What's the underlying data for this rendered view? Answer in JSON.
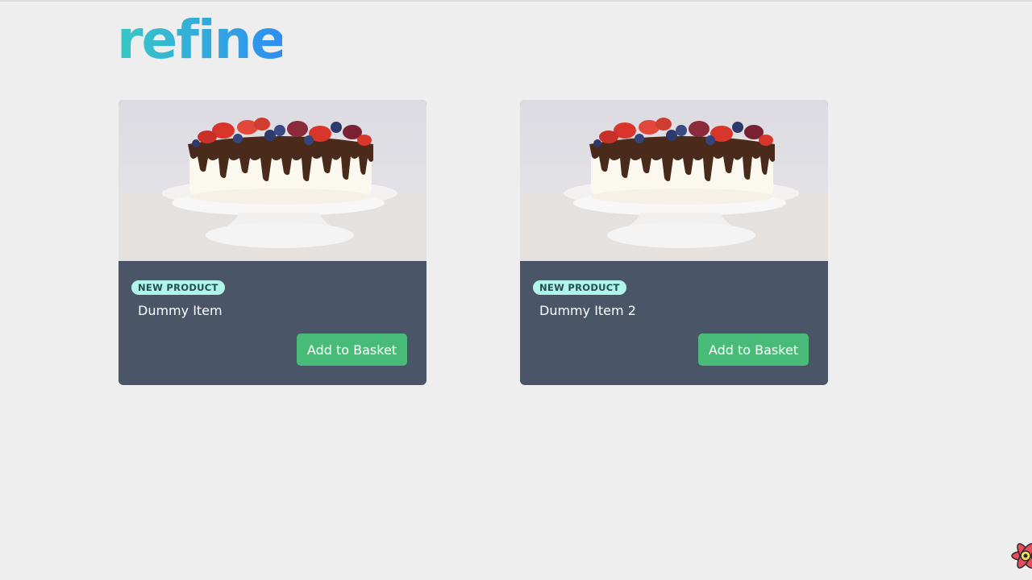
{
  "header": {
    "logo_text": "refine"
  },
  "products": [
    {
      "badge": "NEW PRODUCT",
      "title": "Dummy Item",
      "button_label": "Add to Basket",
      "image_alt": "cake"
    },
    {
      "badge": "NEW PRODUCT",
      "title": "Dummy Item 2",
      "button_label": "Add to Basket",
      "image_alt": "cake"
    }
  ],
  "colors": {
    "background": "#eeeeee",
    "card": "#4a5568",
    "badge_bg": "#b1f5ea",
    "badge_text": "#234e52",
    "button": "#48bb78",
    "logo_teal": "#39c9c3",
    "logo_blue": "#2d8ef2"
  },
  "icons": {
    "devtools": "react-devtools-icon"
  }
}
